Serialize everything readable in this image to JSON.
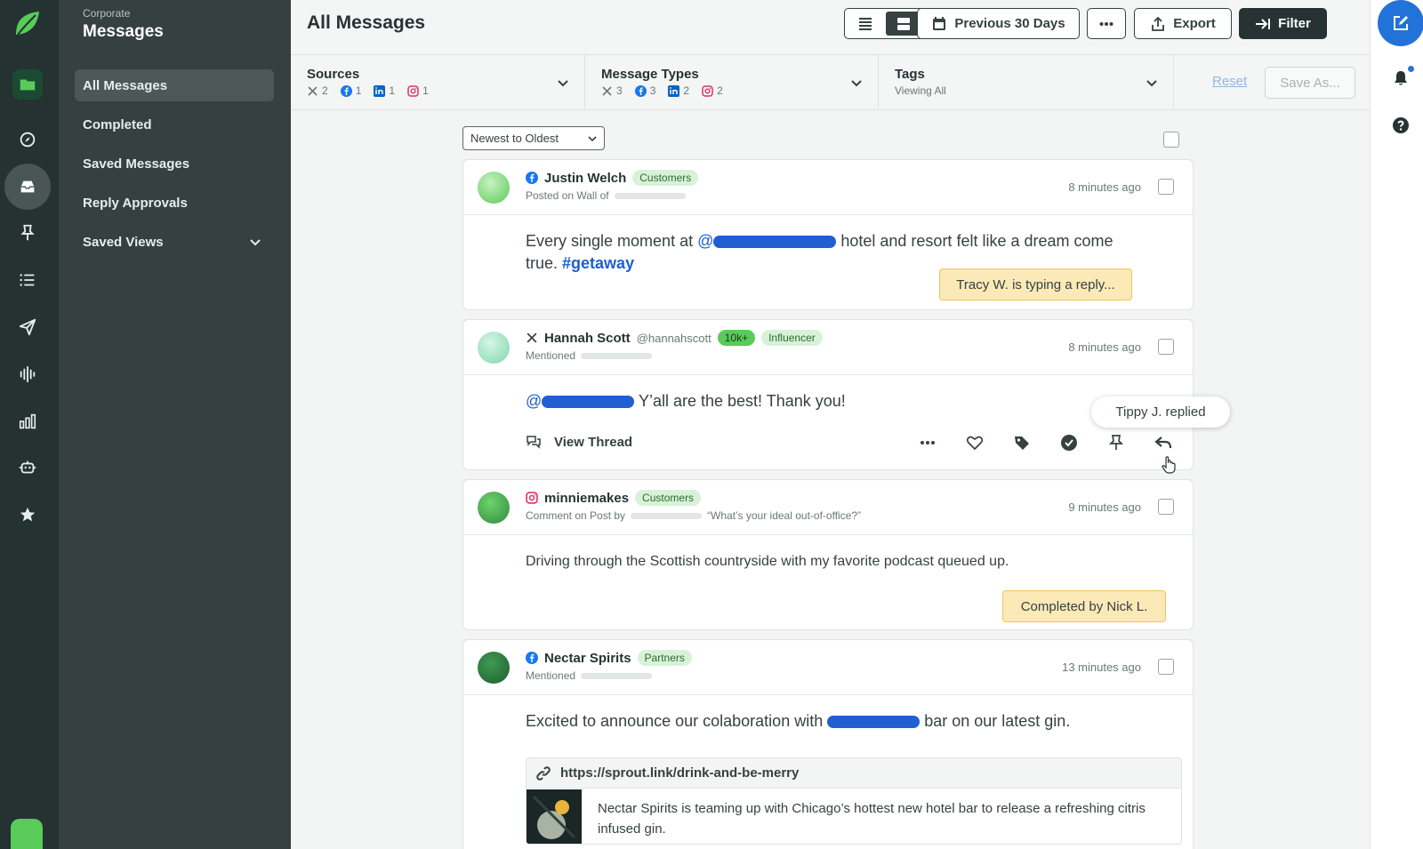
{
  "workspace": {
    "eyebrow": "Corporate",
    "title": "Messages"
  },
  "nav": {
    "items": [
      {
        "label": "All Messages"
      },
      {
        "label": "Completed"
      },
      {
        "label": "Saved Messages"
      },
      {
        "label": "Reply Approvals"
      },
      {
        "label": "Saved Views"
      }
    ]
  },
  "header": {
    "title": "All Messages",
    "date_range_label": "Previous 30 Days",
    "export_label": "Export",
    "filter_label": "Filter"
  },
  "filters": {
    "sources": {
      "label": "Sources",
      "counts": {
        "x": "2",
        "facebook": "1",
        "linkedin": "1",
        "instagram": "1"
      }
    },
    "message_types": {
      "label": "Message Types",
      "counts": {
        "x": "3",
        "facebook": "3",
        "linkedin": "2",
        "instagram": "2"
      }
    },
    "tags": {
      "label": "Tags",
      "value": "Viewing All"
    },
    "reset_label": "Reset",
    "save_as_label": "Save As..."
  },
  "sort": {
    "selected": "Newest to Oldest"
  },
  "messages": [
    {
      "network": "facebook-icon",
      "name": "Justin Welch",
      "tags": [
        "Customers"
      ],
      "context": "Posted on Wall of",
      "time": "8 minutes ago",
      "text_before": "Every single moment at ",
      "mention_prefix": "@",
      "text_after": " hotel and resort felt like a dream come true. ",
      "hashtag": "#getaway",
      "status": "Tracy W. is typing a reply..."
    },
    {
      "network": "x-icon",
      "name": "Hannah Scott",
      "handle": "@hannahscott",
      "tags": [
        "10k+",
        "Influencer"
      ],
      "context": "Mentioned",
      "time": "8 minutes ago",
      "mention_prefix": "@",
      "text_after": " Y’all are the best! Thank you!",
      "view_thread_label": "View Thread",
      "tooltip": "Tippy J. replied"
    },
    {
      "network": "instagram-icon",
      "name": "minniemakes",
      "tags": [
        "Customers"
      ],
      "context": "Comment on Post by",
      "context_quote": "“What’s your ideal out-of-office?”",
      "time": "9 minutes ago",
      "text": "Driving through the Scottish countryside with my favorite podcast queued up.",
      "status": "Completed by Nick L."
    },
    {
      "network": "facebook-icon",
      "name": "Nectar Spirits",
      "tags": [
        "Partners"
      ],
      "context": "Mentioned",
      "time": "13 minutes ago",
      "text_before": "Excited to announce our colaboration with ",
      "text_after": " bar on our latest gin.",
      "link_url": "https://sprout.link/drink-and-be-merry",
      "link_description": "Nectar Spirits is teaming up with Chicago’s hottest new hotel bar to release a refreshing citris infused gin."
    }
  ],
  "colors": {
    "rail": "#243232",
    "nav": "#36403f",
    "brand_green": "#59cb59",
    "accent_blue": "#2273d9",
    "status_yellow": "#fbeab8"
  }
}
